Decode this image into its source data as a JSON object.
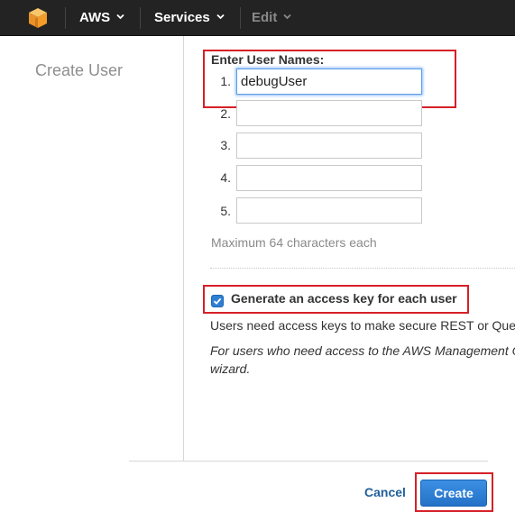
{
  "navbar": {
    "logo_icon": "aws-cube-icon",
    "aws_label": "AWS",
    "services_label": "Services",
    "edit_label": "Edit"
  },
  "page": {
    "title": "Create User"
  },
  "form": {
    "heading": "Enter User Names:",
    "rows": [
      {
        "number": "1.",
        "value": "debugUser"
      },
      {
        "number": "2.",
        "value": ""
      },
      {
        "number": "3.",
        "value": ""
      },
      {
        "number": "4.",
        "value": ""
      },
      {
        "number": "5.",
        "value": ""
      }
    ],
    "hint": "Maximum 64 characters each",
    "generate_key_label": "Generate an access key for each user",
    "generate_key_checked": true,
    "info_text": "Users need access keys to make secure REST or Que",
    "info_italic_line1": "For users who need access to the AWS Management C",
    "info_italic_line2": "wizard."
  },
  "footer": {
    "cancel_label": "Cancel",
    "create_label": "Create"
  },
  "colors": {
    "navbar_bg": "#232323",
    "highlight_red": "#d62027",
    "primary_blue": "#2f7fd3",
    "link_blue": "#1f5f9c"
  }
}
